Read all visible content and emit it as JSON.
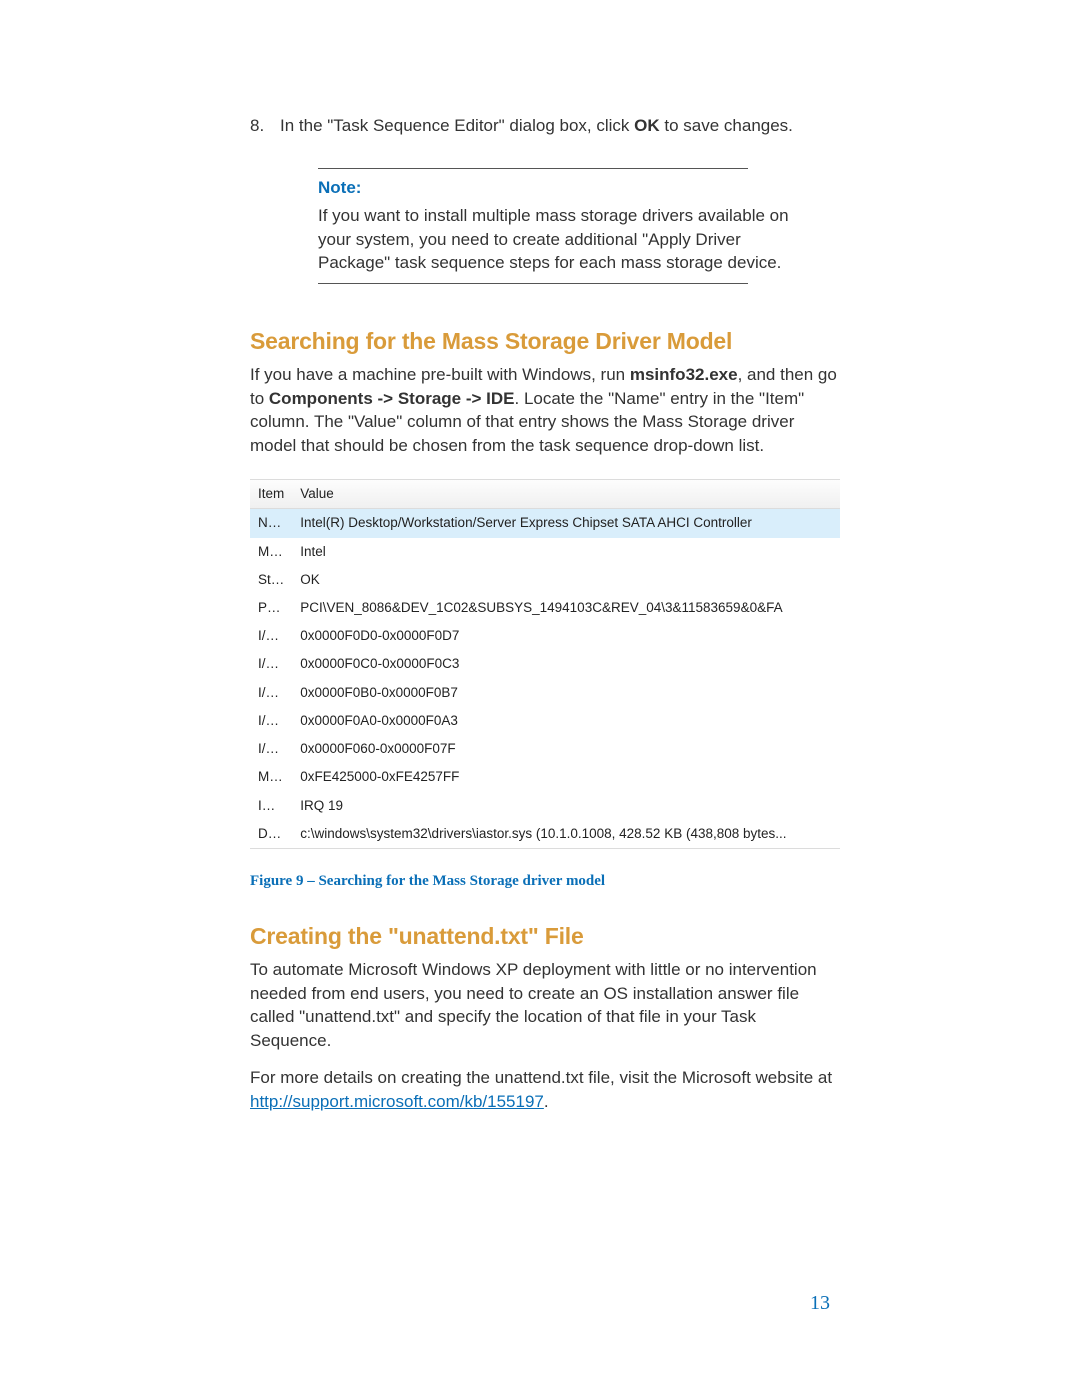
{
  "step": {
    "num": "8.",
    "text_pre": "In the \"Task Sequence Editor\" dialog box, click ",
    "bold": "OK",
    "text_post": " to save changes."
  },
  "note": {
    "label": "Note:",
    "body": "If you want to install multiple mass storage drivers available on your system, you need to create additional \"Apply Driver Package\" task sequence steps for each mass storage device."
  },
  "section1": {
    "heading": "Searching for the Mass Storage Driver Model",
    "p_pre": "If you have a machine pre-built with Windows, run ",
    "p_b1": "msinfo32.exe",
    "p_mid": ", and then go to ",
    "p_b2": "Components -> Storage -> IDE",
    "p_post": ". Locate the \"Name\" entry in the \"Item\" column. The \"Value\" column of that entry shows the Mass Storage driver model that should be chosen from the task sequence drop-down list."
  },
  "table": {
    "headers": {
      "item": "Item",
      "value": "Value"
    },
    "rows": [
      {
        "item": "Name",
        "value": "Intel(R) Desktop/Workstation/Server Express Chipset SATA AHCI Controller",
        "hl": true
      },
      {
        "item": "Manufacturer",
        "value": "Intel",
        "hl": false
      },
      {
        "item": "Status",
        "value": "OK",
        "hl": false
      },
      {
        "item": "PNP Device ID",
        "value": "PCI\\VEN_8086&DEV_1C02&SUBSYS_1494103C&REV_04\\3&11583659&0&FA",
        "hl": false
      },
      {
        "item": "I/O Port",
        "value": "0x0000F0D0-0x0000F0D7",
        "hl": false
      },
      {
        "item": "I/O Port",
        "value": "0x0000F0C0-0x0000F0C3",
        "hl": false
      },
      {
        "item": "I/O Port",
        "value": "0x0000F0B0-0x0000F0B7",
        "hl": false
      },
      {
        "item": "I/O Port",
        "value": "0x0000F0A0-0x0000F0A3",
        "hl": false
      },
      {
        "item": "I/O Port",
        "value": "0x0000F060-0x0000F07F",
        "hl": false
      },
      {
        "item": "Memory Address",
        "value": "0xFE425000-0xFE4257FF",
        "hl": false
      },
      {
        "item": "IRQ Channel",
        "value": "IRQ 19",
        "hl": false
      },
      {
        "item": "Driver",
        "value": "c:\\windows\\system32\\drivers\\iastor.sys (10.1.0.1008, 428.52 KB (438,808 bytes...",
        "hl": false
      }
    ]
  },
  "figcap": "Figure 9 – Searching for the Mass Storage driver model",
  "section2": {
    "heading": "Creating the \"unattend.txt\" File",
    "p1": "To automate Microsoft Windows XP deployment with little or no intervention needed from end users, you need to create an OS installation answer file called \"unattend.txt\" and specify the location of that file in your Task Sequence.",
    "p2_pre": "For more details on creating the unattend.txt file, visit the Microsoft website at ",
    "link": "http://support.microsoft.com/kb/155197",
    "p2_post": "."
  },
  "pagenum": "13"
}
